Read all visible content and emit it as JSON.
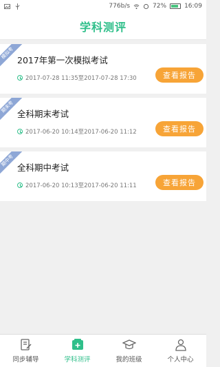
{
  "status_bar": {
    "speed": "776b/s",
    "battery_percent": "72%",
    "time": "16:09"
  },
  "header": {
    "title": "学科测评"
  },
  "exams": [
    {
      "tag": "模拟考",
      "name": "2017年第一次模拟考试",
      "time": "2017-07-28 11:35至2017-07-28 17:30",
      "button": "查看报告"
    },
    {
      "tag": "期末考",
      "name": "全科期末考试",
      "time": "2017-06-20 10:14至2017-06-20 11:12",
      "button": "查看报告"
    },
    {
      "tag": "期中考",
      "name": "全科期中考试",
      "time": "2017-06-20 10:13至2017-06-20 11:11",
      "button": "查看报告"
    }
  ],
  "tabbar": {
    "items": [
      {
        "label": "同步辅导",
        "icon": "book-edit-icon",
        "active": false
      },
      {
        "label": "学科测评",
        "icon": "assessment-icon",
        "active": true
      },
      {
        "label": "我的班级",
        "icon": "graduation-cap-icon",
        "active": false
      },
      {
        "label": "个人中心",
        "icon": "person-icon",
        "active": false
      }
    ]
  },
  "colors": {
    "accent": "#2fbf8a",
    "button": "#f7a437",
    "tag": "#8ea7d6"
  }
}
